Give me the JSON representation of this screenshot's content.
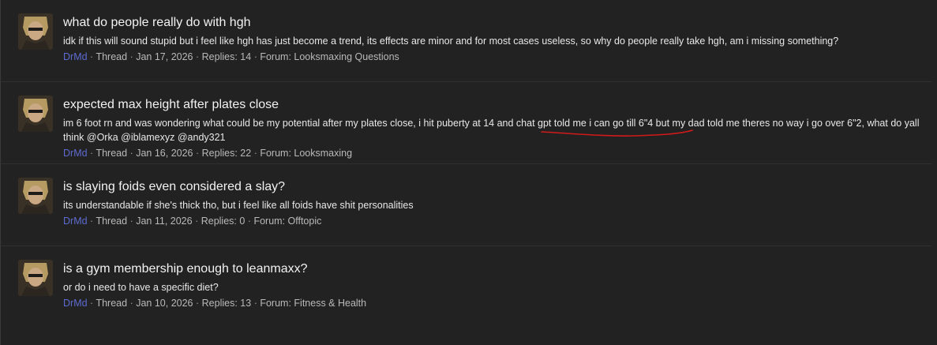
{
  "results": [
    {
      "title": "what do people really do with hgh",
      "snippet": "idk if this will sound stupid but i feel like hgh has just become a trend, its effects are minor and for most cases useless, so why do people really take hgh, am i missing something?",
      "user": "DrMd",
      "type": "Thread",
      "date": "Jan 17, 2026",
      "replies": "Replies: 14",
      "forum": "Forum: Looksmaxing Questions"
    },
    {
      "title": "expected max height after plates close",
      "snippet": "im 6 foot rn and was wondering what could be my potential after my plates close, i hit puberty at 14 and chat gpt told me i can go till 6\"4 but my dad told me theres no way i go over 6\"2, what do yall think @Orka @iblamexyz @andy321",
      "user": "DrMd",
      "type": "Thread",
      "date": "Jan 16, 2026",
      "replies": "Replies: 22",
      "forum": "Forum: Looksmaxing"
    },
    {
      "title": "is slaying foids even considered a slay?",
      "snippet": "its understandable if she's thick tho, but i feel like all foids have shit personalities",
      "user": "DrMd",
      "type": "Thread",
      "date": "Jan 11, 2026",
      "replies": "Replies: 0",
      "forum": "Forum: Offtopic"
    },
    {
      "title": "is a gym membership enough to leanmaxx?",
      "snippet": "or do i need to have a specific diet?",
      "user": "DrMd",
      "type": "Thread",
      "date": "Jan 10, 2026",
      "replies": "Replies: 13",
      "forum": "Forum: Fitness & Health"
    }
  ],
  "separator": "·",
  "colors": {
    "background": "#222222",
    "username": "#5e6bd1",
    "annotation": "#d11a1a"
  },
  "icons": {
    "avatar": "user-avatar-image"
  }
}
